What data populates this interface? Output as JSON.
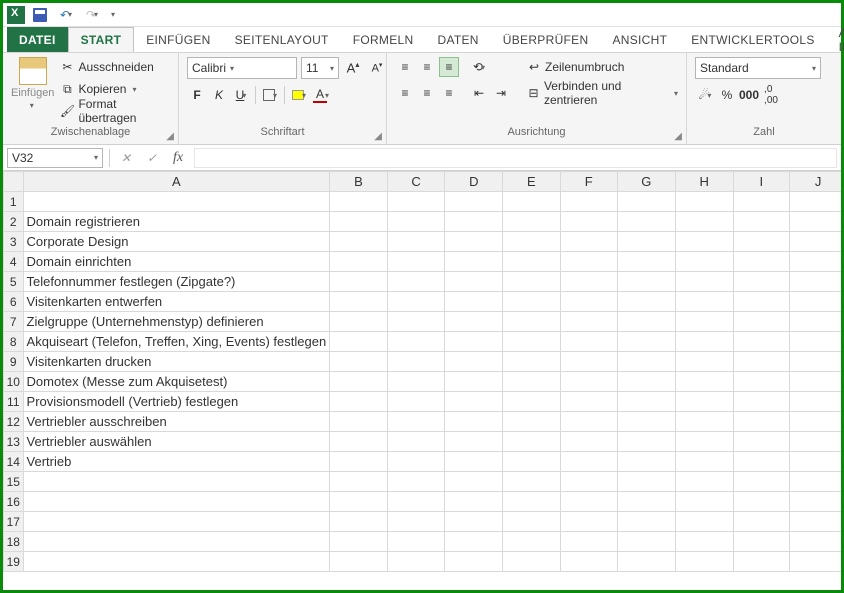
{
  "qat": {
    "save": "save",
    "undo": "undo",
    "redo": "redo"
  },
  "tabs": {
    "file": "DATEI",
    "items": [
      "START",
      "EINFÜGEN",
      "SEITENLAYOUT",
      "FORMELN",
      "DATEN",
      "ÜBERPRÜFEN",
      "ANSICHT",
      "ENTWICKLERTOOLS",
      "ADD-IN"
    ],
    "active_index": 0
  },
  "ribbon": {
    "clipboard": {
      "paste": "Einfügen",
      "cut": "Ausschneiden",
      "copy": "Kopieren",
      "format_painter": "Format übertragen",
      "label": "Zwischenablage"
    },
    "font": {
      "name": "Calibri",
      "size": "11",
      "bold": "F",
      "italic": "K",
      "underline": "U",
      "label": "Schriftart"
    },
    "alignment": {
      "wrap": "Zeilenumbruch",
      "merge": "Verbinden und zentrieren",
      "label": "Ausrichtung"
    },
    "number": {
      "format": "Standard",
      "label": "Zahl"
    }
  },
  "formula_bar": {
    "name_box": "V32",
    "formula": ""
  },
  "columns": [
    "A",
    "B",
    "C",
    "D",
    "E",
    "F",
    "G",
    "H",
    "I",
    "J"
  ],
  "rows": [
    {
      "n": 1,
      "a": ""
    },
    {
      "n": 2,
      "a": "Domain registrieren"
    },
    {
      "n": 3,
      "a": "Corporate Design"
    },
    {
      "n": 4,
      "a": "Domain einrichten"
    },
    {
      "n": 5,
      "a": "Telefonnummer festlegen (Zipgate?)"
    },
    {
      "n": 6,
      "a": "Visitenkarten entwerfen"
    },
    {
      "n": 7,
      "a": "Zielgruppe (Unternehmenstyp) definieren"
    },
    {
      "n": 8,
      "a": "Akquiseart (Telefon, Treffen, Xing, Events) festlegen"
    },
    {
      "n": 9,
      "a": "Visitenkarten drucken"
    },
    {
      "n": 10,
      "a": "Domotex (Messe zum Akquisetest)"
    },
    {
      "n": 11,
      "a": "Provisionsmodell (Vertrieb) festlegen"
    },
    {
      "n": 12,
      "a": "Vertriebler ausschreiben"
    },
    {
      "n": 13,
      "a": "Vertriebler auswählen"
    },
    {
      "n": 14,
      "a": "Vertrieb"
    },
    {
      "n": 15,
      "a": ""
    },
    {
      "n": 16,
      "a": ""
    },
    {
      "n": 17,
      "a": ""
    },
    {
      "n": 18,
      "a": ""
    },
    {
      "n": 19,
      "a": ""
    }
  ]
}
